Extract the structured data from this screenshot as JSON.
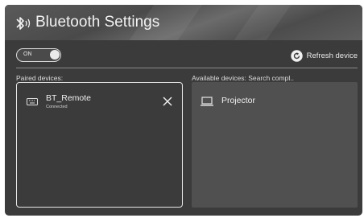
{
  "header": {
    "title": "Bluetooth Settings",
    "icon": "bluetooth-icon"
  },
  "controls": {
    "toggle_label": "ON",
    "toggle_state": "on",
    "refresh_label": "Refresh device",
    "refresh_icon": "refresh-icon"
  },
  "paired": {
    "heading": "Paired devices:",
    "devices": [
      {
        "name": "BT_Remote",
        "status": "Connected",
        "icon": "keyboard-icon",
        "action_icon": "close-icon"
      }
    ]
  },
  "available": {
    "heading": "Available devices: Search compl..",
    "devices": [
      {
        "name": "Projector",
        "icon": "laptop-icon"
      }
    ]
  },
  "colors": {
    "background": "#3b3b3b",
    "panel": "#505050",
    "text": "#f0f0f0"
  }
}
